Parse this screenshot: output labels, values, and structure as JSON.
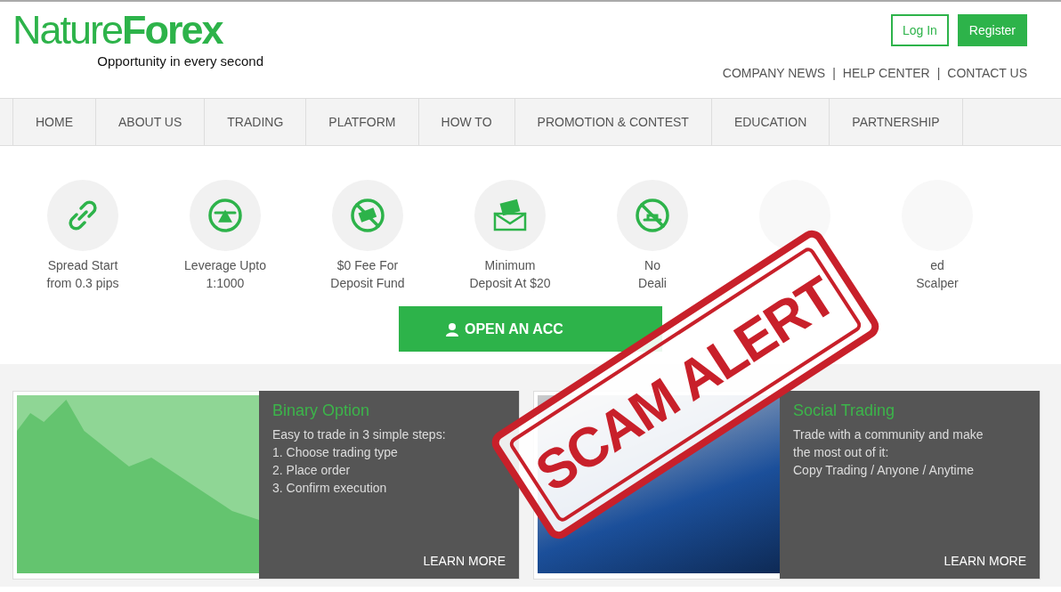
{
  "logo": {
    "word_light": "Nature",
    "word_bold": "Forex",
    "tagline": "Opportunity in every second"
  },
  "auth_buttons": [
    {
      "label": "Log In",
      "kind": "outline"
    },
    {
      "label": "Register",
      "kind": "filled"
    }
  ],
  "top_links": [
    "COMPANY NEWS",
    "HELP CENTER",
    "CONTACT US"
  ],
  "top_link_separator": "|",
  "nav": [
    {
      "label": "HOME"
    },
    {
      "label": "ABOUT US"
    },
    {
      "label": "TRADING"
    },
    {
      "label": "PLATFORM"
    },
    {
      "label": "HOW TO"
    },
    {
      "label": "PROMOTION & CONTEST"
    },
    {
      "label": "EDUCATION"
    },
    {
      "label": "PARTNERSHIP"
    }
  ],
  "features": [
    {
      "kind": "link",
      "lines": [
        "Spread Start",
        "from 0.3 pips"
      ]
    },
    {
      "kind": "scale",
      "lines": [
        "Leverage Upto",
        "1:1000"
      ]
    },
    {
      "kind": "nofee",
      "lines": [
        "$0 Fee For",
        "Deposit Fund"
      ]
    },
    {
      "kind": "envelope",
      "lines": [
        "Minimum",
        "Deposit At $20"
      ]
    },
    {
      "kind": "nodesk",
      "lines": [
        "No",
        "Deali"
      ]
    },
    {
      "kind": "covered"
    },
    {
      "kind": "partial",
      "lines": [
        "ed",
        "Scalper"
      ]
    }
  ],
  "open_account": {
    "label": "OPEN AN ACC"
  },
  "cards": [
    {
      "kind": "binary",
      "title": "Binary Option",
      "lines": [
        "Easy to trade in 3 simple steps:",
        "1. Choose trading type",
        "2. Place order",
        "3. Confirm execution"
      ],
      "link": "LEARN MORE"
    },
    {
      "kind": "social",
      "title": "Social Trading",
      "lines": [
        "Trade with a community and make",
        "the most out of it:",
        "Copy Trading / Anyone / Anytime"
      ],
      "link": "LEARN MORE"
    }
  ],
  "stamp": {
    "text": "SCAM ALERT"
  }
}
